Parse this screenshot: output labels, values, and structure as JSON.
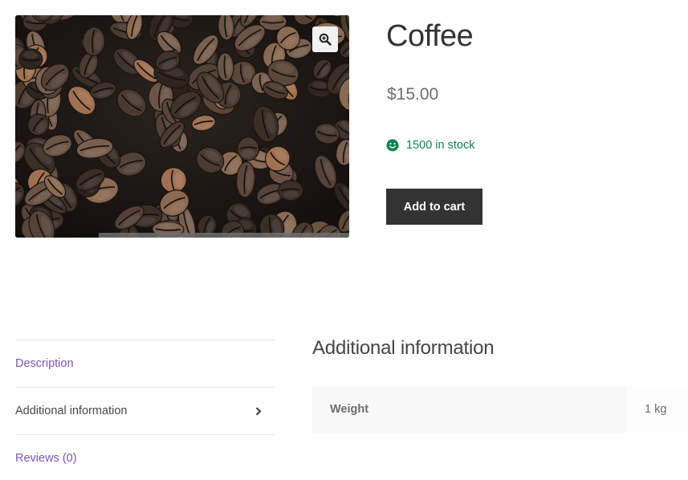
{
  "product": {
    "title": "Coffee",
    "price": "$15.00",
    "stock_text": "1500 in stock",
    "add_to_cart_label": "Add to cart",
    "image_alt": "Coffee beans"
  },
  "gallery": {
    "zoom_icon": "magnifier-zoom-icon"
  },
  "tabs": {
    "items": [
      {
        "label": "Description"
      },
      {
        "label": "Additional information",
        "active": true
      },
      {
        "label": "Reviews (0)"
      }
    ]
  },
  "panel": {
    "title": "Additional information",
    "attributes": [
      {
        "label": "Weight",
        "value": "1 kg"
      }
    ]
  },
  "colors": {
    "tab_link": "#7f54b3",
    "stock_green": "#0f834d",
    "button_bg": "#333333"
  }
}
